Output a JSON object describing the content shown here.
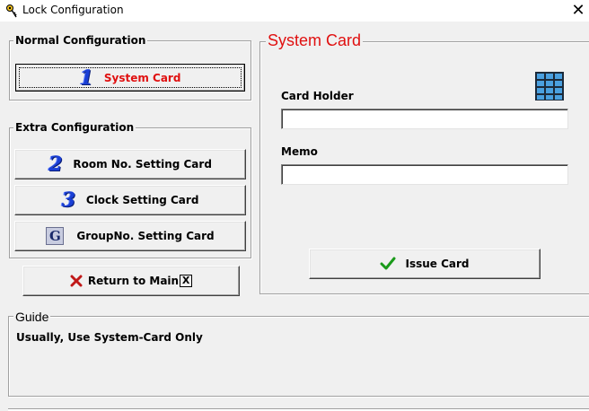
{
  "window": {
    "title": "Lock Configuration",
    "close_glyph": "✕"
  },
  "normal_config": {
    "legend": "Normal Configuration",
    "system_card_button": {
      "number": "1",
      "label": "System Card"
    }
  },
  "extra_config": {
    "legend": "Extra Configuration",
    "room_button": {
      "number": "2",
      "label": "Room No. Setting Card"
    },
    "clock_button": {
      "number": "3",
      "label": "Clock Setting Card"
    },
    "group_button": {
      "badge": "G",
      "label": "GroupNo. Setting Card"
    }
  },
  "return_button": {
    "label": "Return to Main",
    "hotkey_glyph": "X"
  },
  "system_card_panel": {
    "legend": "System Card",
    "card_holder_label": "Card Holder",
    "card_holder_value": "",
    "memo_label": "Memo",
    "memo_value": "",
    "issue_button": {
      "label": "Issue Card"
    },
    "keypad_icon": "keypad-icon"
  },
  "guide": {
    "legend": "Guide",
    "text": "Usually, Use System-Card Only"
  },
  "colors": {
    "accent_red": "#e01010",
    "number_blue": "#1a3fd6",
    "check_green": "#1a9a1a",
    "x_red": "#c01818"
  }
}
